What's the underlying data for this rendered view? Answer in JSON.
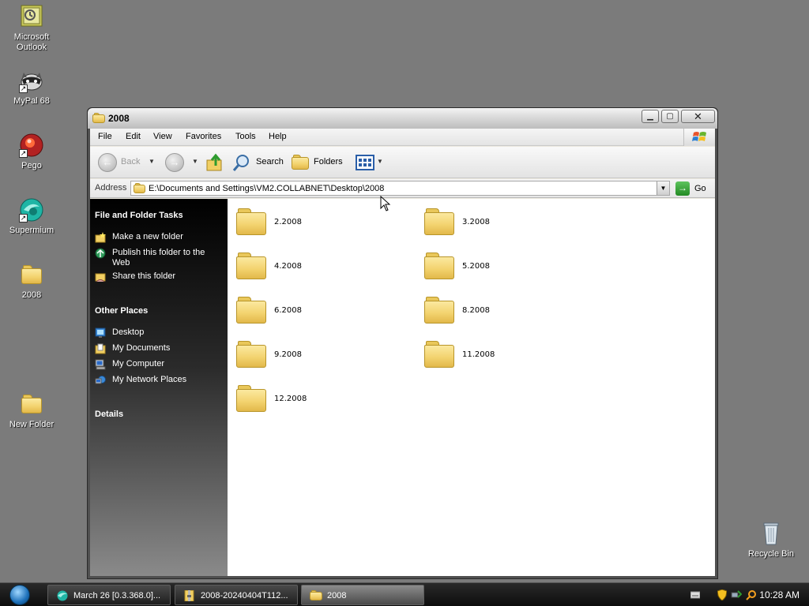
{
  "desktop": {
    "icons": [
      {
        "label": "Microsoft\nOutlook"
      },
      {
        "label": "MyPal 68"
      },
      {
        "label": "Pego"
      },
      {
        "label": "Supermium"
      },
      {
        "label": "2008"
      },
      {
        "label": "New Folder"
      },
      {
        "label": "Recycle Bin"
      }
    ]
  },
  "window": {
    "title": "2008",
    "menu": [
      "File",
      "Edit",
      "View",
      "Favorites",
      "Tools",
      "Help"
    ],
    "toolbar": {
      "back_label": "Back",
      "search_label": "Search",
      "folders_label": "Folders"
    },
    "address": {
      "label": "Address",
      "value": "E:\\Documents and Settings\\VM2.COLLABNET\\Desktop\\2008",
      "go_label": "Go"
    },
    "taskpane": {
      "file_tasks_title": "File and Folder Tasks",
      "file_tasks": [
        {
          "label": "Make a new folder",
          "icon": "new-folder-icon"
        },
        {
          "label": "Publish this folder to the Web",
          "icon": "publish-web-icon"
        },
        {
          "label": "Share this folder",
          "icon": "share-folder-icon"
        }
      ],
      "other_places_title": "Other Places",
      "other_places": [
        {
          "label": "Desktop",
          "icon": "desktop-icon"
        },
        {
          "label": "My Documents",
          "icon": "my-documents-icon"
        },
        {
          "label": "My Computer",
          "icon": "my-computer-icon"
        },
        {
          "label": "My Network Places",
          "icon": "network-places-icon"
        }
      ],
      "details_title": "Details"
    },
    "folders": [
      "2.2008",
      "3.2008",
      "4.2008",
      "5.2008",
      "6.2008",
      "8.2008",
      "9.2008",
      "11.2008",
      "12.2008"
    ]
  },
  "taskbar": {
    "tasks": [
      {
        "label": "March 26 [0.3.368.0]..."
      },
      {
        "label": "2008-20240404T112..."
      },
      {
        "label": "2008"
      }
    ],
    "clock": "10:28 AM"
  }
}
